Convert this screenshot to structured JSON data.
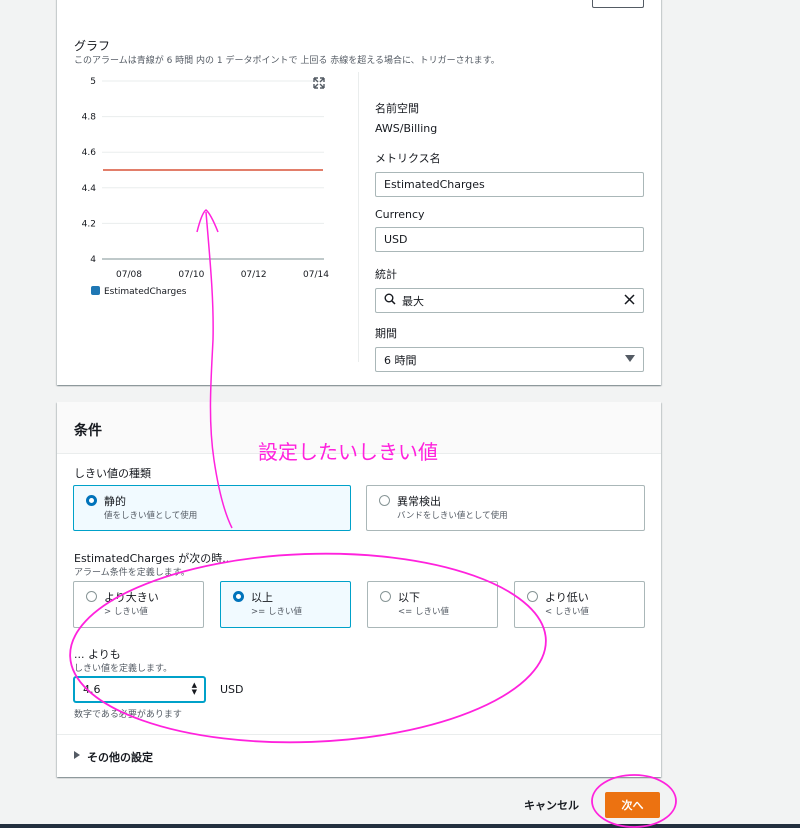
{
  "graph": {
    "title": "グラフ",
    "description": "このアラームは青線が 6 時間 内の 1 データポイントで 上回る 赤線を超える場合に、トリガーされます。",
    "expand_icon": "expand-icon"
  },
  "chart_data": {
    "type": "line",
    "x": [
      "07/08",
      "07/10",
      "07/12",
      "07/14"
    ],
    "y_ticks": [
      5,
      4.8,
      4.6,
      4.4,
      4.2,
      4
    ],
    "ylim": [
      4,
      5
    ],
    "series": [
      {
        "name": "EstimatedCharges",
        "values": [],
        "color": "#1f77b4"
      }
    ],
    "threshold": {
      "value": 4.5,
      "color": "#d13212"
    },
    "legend": "bottom-left",
    "grid": true
  },
  "metric": {
    "namespace_label": "名前空間",
    "namespace_value": "AWS/Billing",
    "metric_name_label": "メトリクス名",
    "metric_name_value": "EstimatedCharges",
    "currency_label": "Currency",
    "currency_value": "USD",
    "statistic_label": "統計",
    "statistic_value": "最大",
    "period_label": "期間",
    "period_value": "6 時間"
  },
  "conditions": {
    "title": "条件",
    "threshold_type_label": "しきい値の種類",
    "static_label": "静的",
    "static_sub": "値をしきい値として使用",
    "anomaly_label": "異常検出",
    "anomaly_sub": "バンドをしきい値として使用",
    "when_label": "EstimatedCharges が次の時...",
    "when_sub": "アラーム条件を定義します。",
    "ops": [
      {
        "label": "より大きい",
        "sub": "> しきい値"
      },
      {
        "label": "以上",
        "sub": ">= しきい値"
      },
      {
        "label": "以下",
        "sub": "<= しきい値"
      },
      {
        "label": "より低い",
        "sub": "< しきい値"
      }
    ],
    "than_label": "... よりも",
    "than_sub": "しきい値を定義します。",
    "threshold_value": "4.6",
    "unit": "USD",
    "hint": "数字である必要があります",
    "other_settings": "その他の設定"
  },
  "footer": {
    "cancel": "キャンセル",
    "next": "次へ"
  },
  "annotation": {
    "text": "設定したいしきい値",
    "color": "#ff22dd"
  }
}
